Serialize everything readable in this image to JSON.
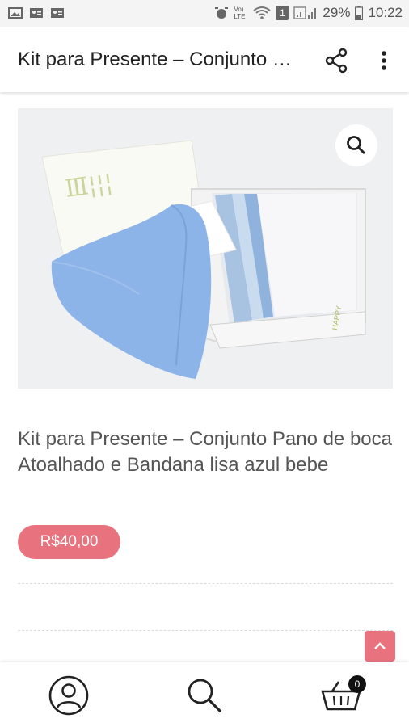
{
  "status_bar": {
    "battery": "29%",
    "time": "10:22",
    "network_label": "Vo) LTE",
    "notification_count": "1",
    "icons": [
      "image-icon",
      "contact-card-icon",
      "contact-card-icon",
      "alarm-icon",
      "volte-icon",
      "wifi-icon",
      "notification-icon",
      "signal-icon",
      "battery-icon"
    ]
  },
  "app_bar": {
    "title": "Kit para Presente – Conjunto Pano de boca Atoalhado e Bandana lisa azul bebe",
    "share_icon": "share-icon",
    "more_icon": "more-vert-icon"
  },
  "product": {
    "image_alt": "Kit para Presente – Conjunto Pano de boca Atoalhado e Bandana lisa azul bebe",
    "zoom_icon": "search-icon",
    "title": "Kit para Presente – Conjunto Pano de boca Atoalhado e Bandana lisa azul bebe",
    "price": "R$40,00",
    "box_print": "HAPPY"
  },
  "colors": {
    "accent": "#e8737f",
    "text": "#555555",
    "title": "#222222"
  },
  "bottom_nav": {
    "account_icon": "account-icon",
    "search_icon": "search-icon",
    "cart_icon": "cart-icon",
    "cart_count": "0"
  },
  "scroll_top_icon": "chevron-up-icon"
}
